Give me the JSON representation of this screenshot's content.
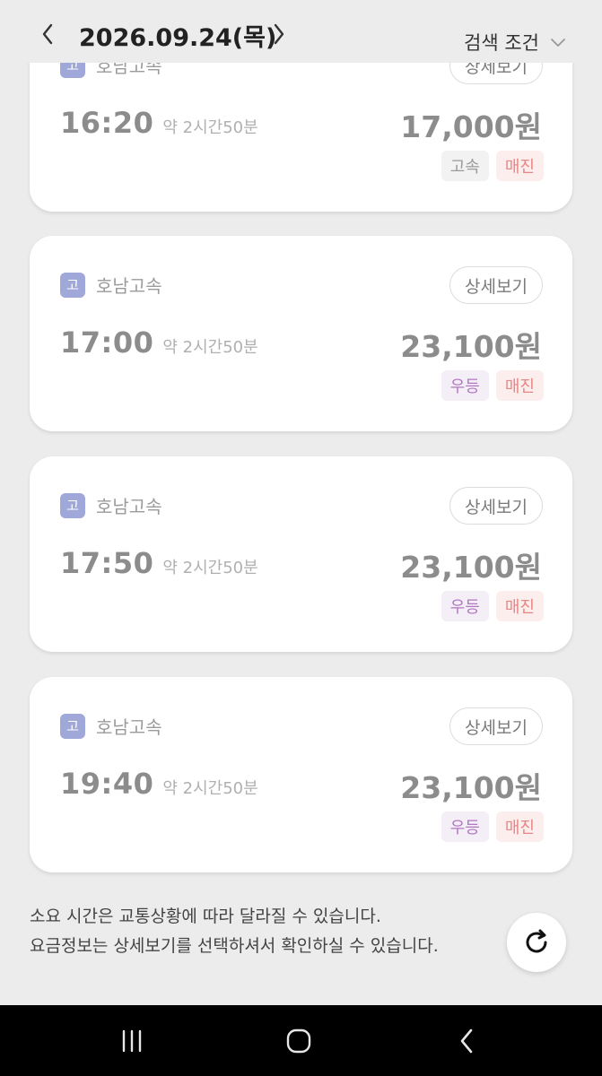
{
  "header": {
    "date": "2026.09.24(목)",
    "prev_icon": "chevron-left-icon",
    "next_icon": "chevron-right-icon",
    "filter_label": "검색 조건",
    "filter_icon": "chevron-down-icon"
  },
  "cards": [
    {
      "operator_badge": "고",
      "operator": "호남고속",
      "detail_label": "상세보기",
      "time": "16:20",
      "duration": "약 2시간50분",
      "price": "17,000원",
      "grade": "고속",
      "status": "매진"
    },
    {
      "operator_badge": "고",
      "operator": "호남고속",
      "detail_label": "상세보기",
      "time": "17:00",
      "duration": "약 2시간50분",
      "price": "23,100원",
      "grade": "우등",
      "status": "매진"
    },
    {
      "operator_badge": "고",
      "operator": "호남고속",
      "detail_label": "상세보기",
      "time": "17:50",
      "duration": "약 2시간50분",
      "price": "23,100원",
      "grade": "우등",
      "status": "매진"
    },
    {
      "operator_badge": "고",
      "operator": "호남고속",
      "detail_label": "상세보기",
      "time": "19:40",
      "duration": "약 2시간50분",
      "price": "23,100원",
      "grade": "우등",
      "status": "매진"
    }
  ],
  "notice": {
    "line1": "소요 시간은 교통상황에 따라 달라질 수 있습니다.",
    "line2": "요금정보는 상세보기를 선택하셔서 확인하실 수 있습니다."
  },
  "refresh_icon": "refresh-icon",
  "navbar": {
    "recent_icon": "recent-apps-icon",
    "home_icon": "home-icon",
    "back_icon": "back-icon"
  },
  "colors": {
    "background": "#ececec",
    "card": "#ffffff",
    "operator_badge": "#9fa8d8",
    "soldout_text": "#e88585",
    "soldout_bg": "#fdeeee",
    "premium_text": "#b277c2",
    "premium_bg": "#f4eef6"
  }
}
